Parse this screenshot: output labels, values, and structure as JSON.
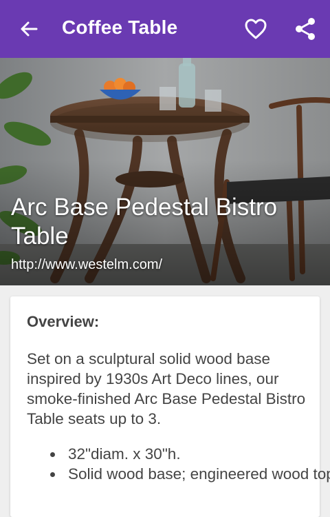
{
  "appbar": {
    "title": "Coffee Table",
    "background_color": "#6a3ab2",
    "icons": [
      "arrow-left-icon",
      "heart-outline-icon",
      "share-icon"
    ]
  },
  "hero": {
    "product_name": "Arc Base Pedestal Bistro Table",
    "url": "http://www.westelm.com/"
  },
  "details": {
    "heading": "Overview:",
    "description": "Set on a sculptural solid wood base inspired by 1930s Art Deco lines, our smoke-finished Arc Base Pedestal Bistro Table seats up to 3.",
    "bullets": [
      "32\"diam. x 30\"h.",
      "Solid wood base; engineered wood top."
    ]
  }
}
